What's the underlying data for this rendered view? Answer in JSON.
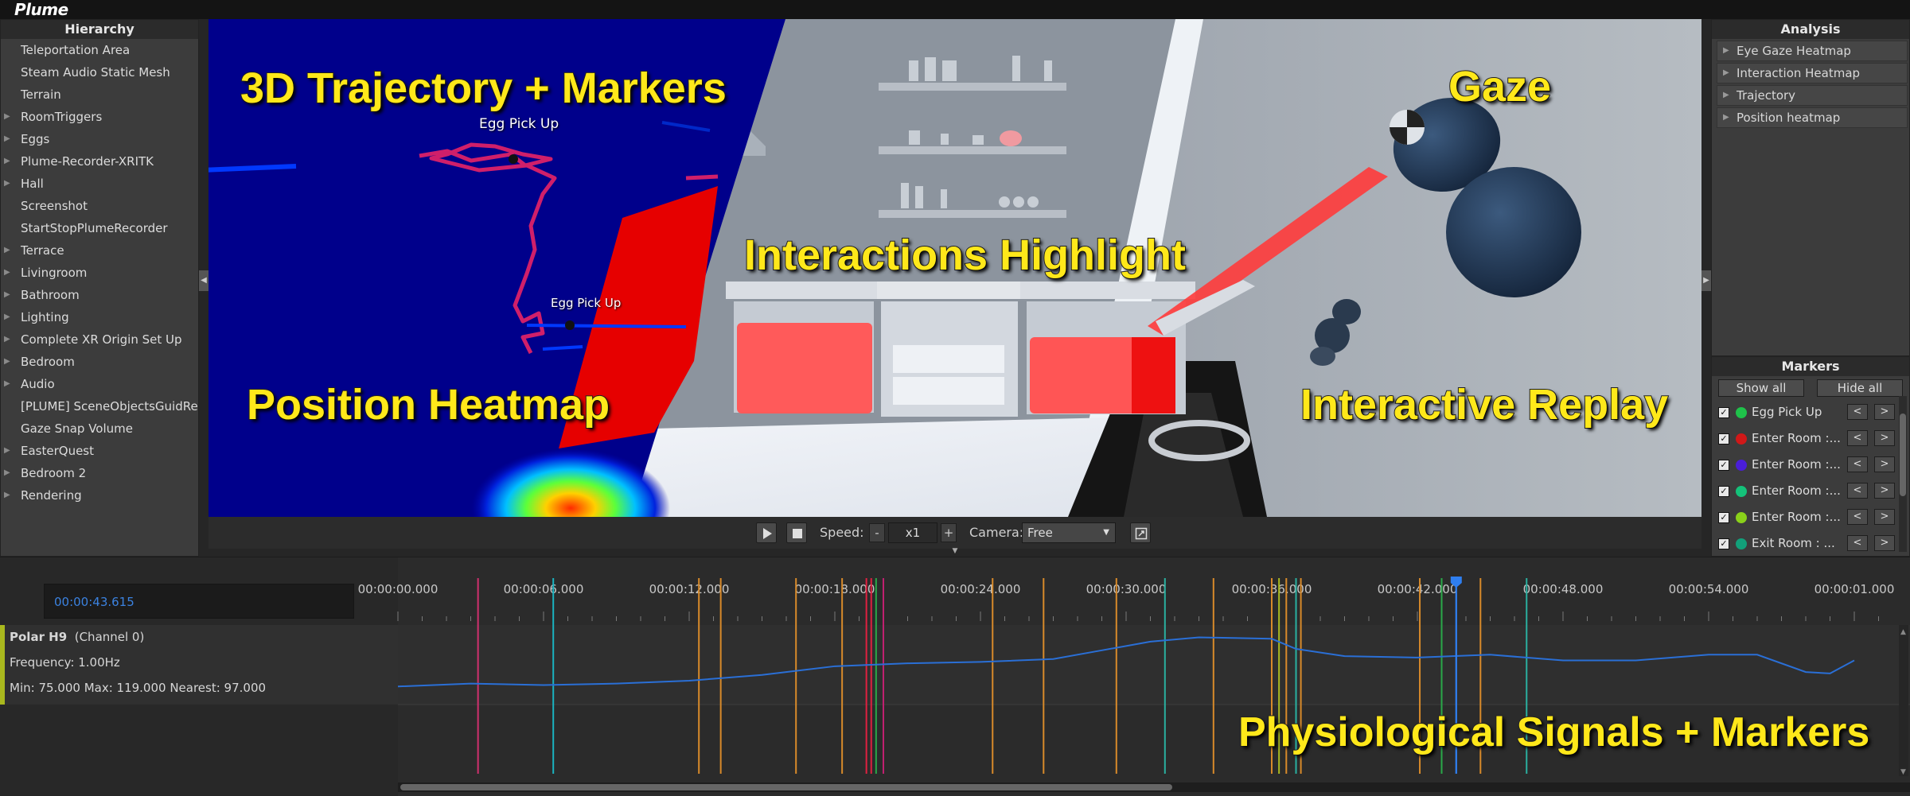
{
  "app": {
    "logo": "Plume"
  },
  "hierarchy": {
    "title": "Hierarchy",
    "items": [
      {
        "label": "Teleportation Area",
        "expandable": false
      },
      {
        "label": "Steam Audio Static Mesh",
        "expandable": false
      },
      {
        "label": "Terrain",
        "expandable": false
      },
      {
        "label": "RoomTriggers",
        "expandable": true
      },
      {
        "label": "Eggs",
        "expandable": true
      },
      {
        "label": "Plume-Recorder-XRITK",
        "expandable": true
      },
      {
        "label": "Hall",
        "expandable": true
      },
      {
        "label": "Screenshot",
        "expandable": false
      },
      {
        "label": "StartStopPlumeRecorder",
        "expandable": false
      },
      {
        "label": "Terrace",
        "expandable": true
      },
      {
        "label": "Livingroom",
        "expandable": true
      },
      {
        "label": "Bathroom",
        "expandable": true
      },
      {
        "label": "Lighting",
        "expandable": true
      },
      {
        "label": "Complete XR Origin Set Up",
        "expandable": true
      },
      {
        "label": "Bedroom",
        "expandable": true
      },
      {
        "label": "Audio",
        "expandable": true
      },
      {
        "label": "[PLUME] SceneObjectsGuidRegistry",
        "expandable": false
      },
      {
        "label": "Gaze Snap Volume",
        "expandable": false
      },
      {
        "label": "EasterQuest",
        "expandable": true
      },
      {
        "label": "Bedroom 2",
        "expandable": true
      },
      {
        "label": "Rendering",
        "expandable": true
      }
    ]
  },
  "viewport": {
    "overlays": {
      "trajectory": "3D Trajectory + Markers",
      "gaze": "Gaze",
      "interactions": "Interactions Highlight",
      "position": "Position Heatmap",
      "replay": "Interactive Replay"
    },
    "marker_labels": [
      "Egg Pick Up",
      "Egg Pick Up"
    ]
  },
  "playbar": {
    "speed_label": "Speed:",
    "speed_minus": "-",
    "speed_value": "x1",
    "speed_plus": "+",
    "camera_label": "Camera:",
    "camera_value": "Free"
  },
  "analysis": {
    "title": "Analysis",
    "items": [
      "Eye Gaze Heatmap",
      "Interaction Heatmap",
      "Trajectory",
      "Position heatmap"
    ]
  },
  "markers": {
    "title": "Markers",
    "show_all": "Show all",
    "hide_all": "Hide all",
    "prev": "<",
    "next": ">",
    "items": [
      {
        "name": "Egg Pick Up",
        "color": "#1fc24a",
        "checked": true
      },
      {
        "name": "Enter Room :...",
        "color": "#d01818",
        "checked": true
      },
      {
        "name": "Enter Room :...",
        "color": "#4a1ed8",
        "checked": true
      },
      {
        "name": "Enter Room :...",
        "color": "#14c27a",
        "checked": true
      },
      {
        "name": "Enter Room :...",
        "color": "#8ad11a",
        "checked": true
      },
      {
        "name": "Exit Room : ...",
        "color": "#12a07a",
        "checked": true
      }
    ]
  },
  "timeline": {
    "current_time": "00:00:43.615",
    "ticks": [
      "00:00:00.000",
      "00:00:06.000",
      "00:00:12.000",
      "00:00:18.000",
      "00:00:24.000",
      "00:00:30.000",
      "00:00:36.000",
      "00:00:42.000",
      "00:00:48.000",
      "00:00:54.000",
      "00:00:01.000"
    ],
    "track": {
      "name": "Polar H9",
      "channel": "(Channel 0)",
      "frequency": "Frequency: 1.00Hz",
      "stats": "Min: 75.000 Max: 119.000 Nearest: 97.000"
    },
    "overlay": "Physiological Signals + Markers",
    "colors": {
      "signal": "#2a6fd6",
      "playhead": "#2f7ff0",
      "track_accent": "#a9b81e"
    }
  }
}
